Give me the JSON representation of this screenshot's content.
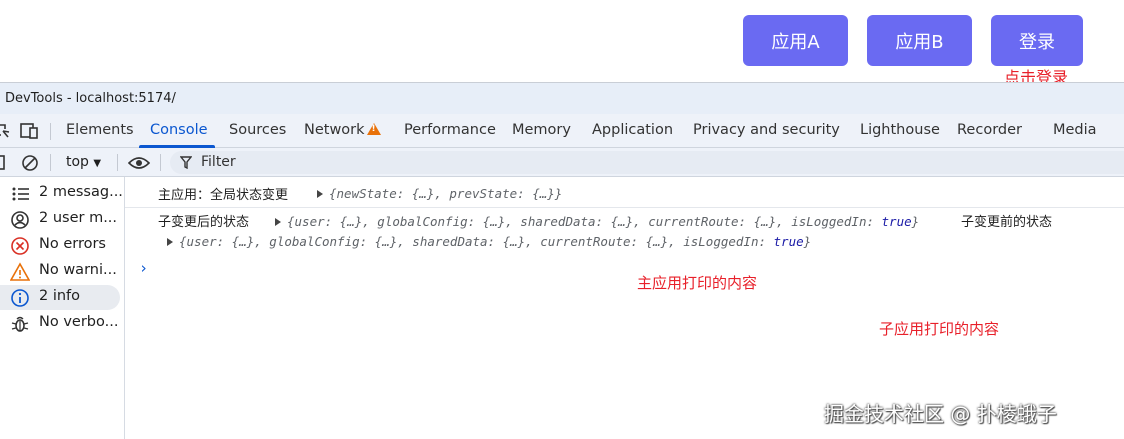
{
  "app": {
    "buttons": {
      "app_a": "应用A",
      "app_b": "应用B",
      "login": "登录"
    },
    "annotation_login": "点击登录"
  },
  "devtools": {
    "title": "DevTools - localhost:5174/",
    "tabs": [
      "Elements",
      "Console",
      "Sources",
      "Network",
      "Performance",
      "Memory",
      "Application",
      "Privacy and security",
      "Lighthouse",
      "Recorder",
      "Media"
    ],
    "active_tab": "Console",
    "toolbar": {
      "context": "top",
      "filter_placeholder": "Filter"
    },
    "sidebar": [
      {
        "label": "2 messag...",
        "icon": "list-icon"
      },
      {
        "label": "2 user m...",
        "icon": "user-circle-icon"
      },
      {
        "label": "No errors",
        "icon": "error-icon"
      },
      {
        "label": "No warni...",
        "icon": "warning-icon"
      },
      {
        "label": "2 info",
        "icon": "info-icon"
      },
      {
        "label": "No verbo...",
        "icon": "bug-icon"
      }
    ],
    "console": {
      "log1": {
        "text": "主应用：全局状态变更",
        "object": "{newState: {…}, prevState: {…}}"
      },
      "log2": {
        "text": "子变更后的状态",
        "object": "{user: {…}, globalConfig: {…}, sharedData: {…}, currentRoute: {…}, isLoggedIn: ",
        "bool": "true",
        "object_end": "}",
        "text2": "子变更前的状态"
      },
      "log3": {
        "object": "{user: {…}, globalConfig: {…}, sharedData: {…}, currentRoute: {…}, isLoggedIn: ",
        "bool": "true",
        "object_end": "}"
      },
      "prompt": "›"
    },
    "annotations": {
      "main_app": "主应用打印的内容",
      "sub_app": "子应用打印的内容"
    }
  },
  "watermark": "掘金技术社区 @ 扑棱蛾子",
  "colors": {
    "button": "#6a6af2",
    "annotation": "#e8202a",
    "accent": "#0b57d0"
  }
}
